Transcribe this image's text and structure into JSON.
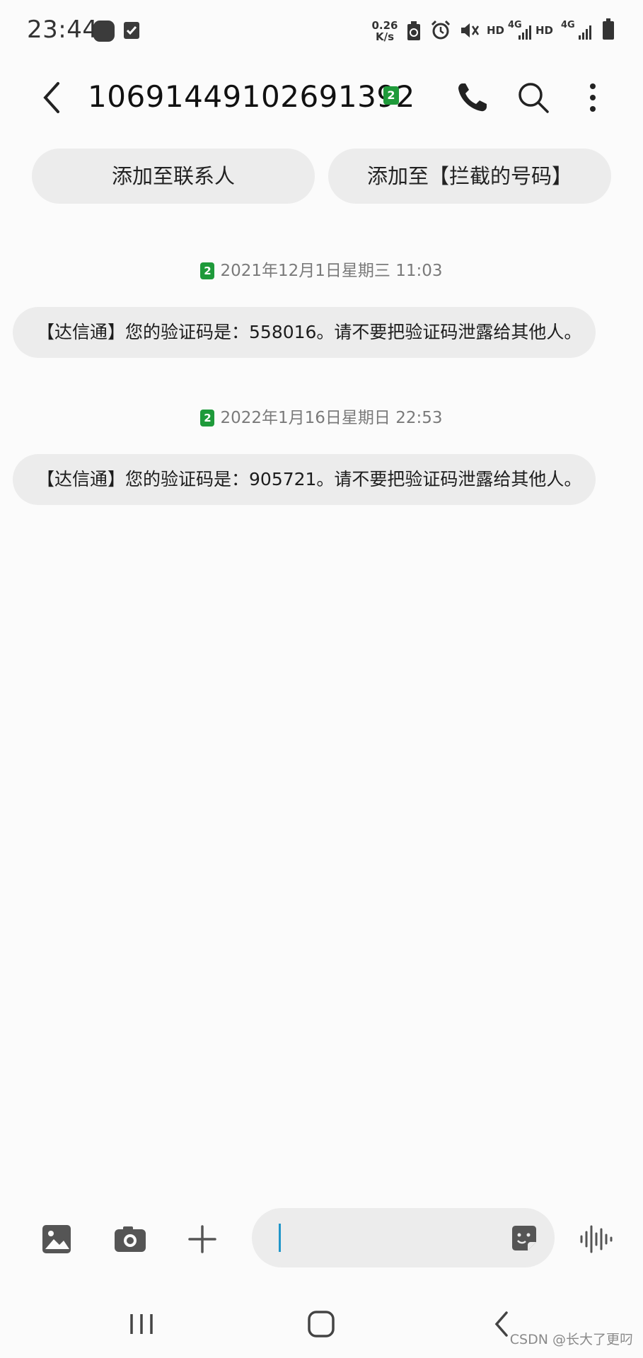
{
  "status_bar": {
    "time": "23:44",
    "net_speed_value": "0.26",
    "net_speed_unit": "K/s",
    "hd1": "HD",
    "g1": "4G",
    "hd2": "HD",
    "g2": "4G",
    "icons": [
      "app-notification-icon",
      "checkbox-notification-icon",
      "battery-saver-icon",
      "alarm-icon",
      "mute-icon",
      "signal-icon",
      "battery-icon"
    ]
  },
  "header": {
    "title": "10691449102691392",
    "sim_badge": "2"
  },
  "actions": {
    "add_contact": "添加至联系人",
    "add_blocked": "添加至【拦截的号码】"
  },
  "messages": [
    {
      "sim": "2",
      "date": "2021年12月1日星期三 11:03",
      "text": "【达信通】您的验证码是：558016。请不要把验证码泄露给其他人。"
    },
    {
      "sim": "2",
      "date": "2022年1月16日星期日 22:53",
      "text": "【达信通】您的验证码是：905721。请不要把验证码泄露给其他人。"
    }
  ],
  "composer": {
    "input_value": "",
    "input_placeholder": ""
  },
  "watermark": "CSDN @长大了更叼",
  "colors": {
    "sim_badge": "#1e9a3a",
    "bubble": "#ececec",
    "background": "#fbfbfb",
    "caret": "#2196c9"
  }
}
